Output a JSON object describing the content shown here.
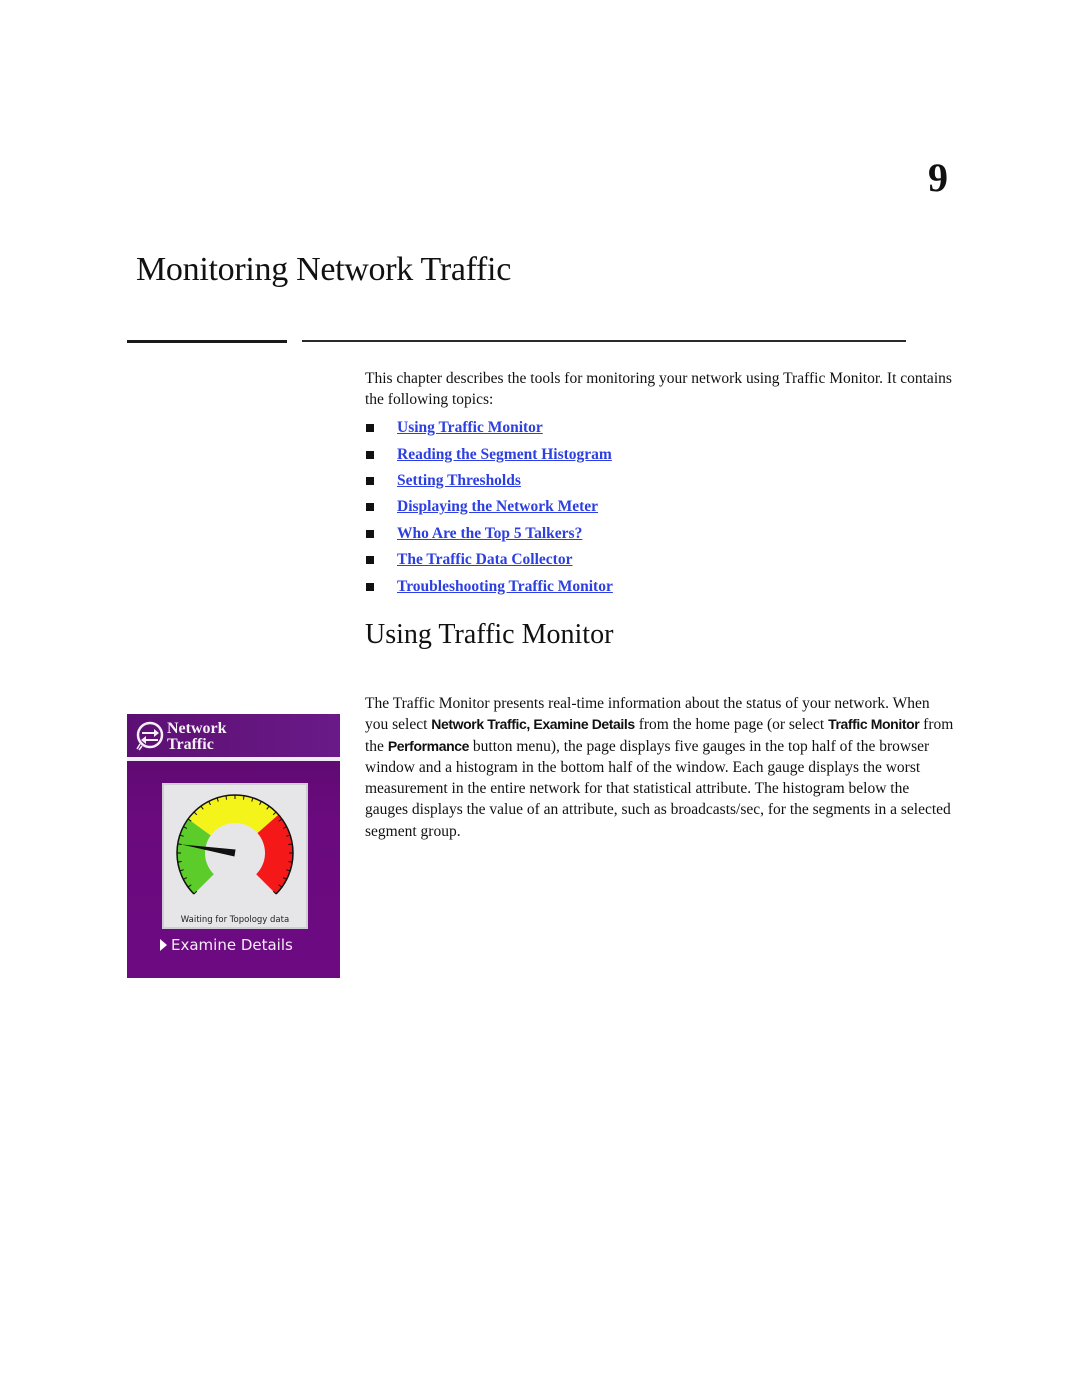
{
  "chapter": {
    "number": "9",
    "title": "Monitoring Network Traffic"
  },
  "intro": {
    "text": "This chapter describes the tools for monitoring your network using Traffic Monitor. It contains the following topics:",
    "topics": [
      "Using Traffic Monitor",
      "Reading the Segment Histogram",
      "Setting Thresholds",
      "Displaying the Network Meter",
      "Who Are the Top 5 Talkers?",
      "The Traffic Data Collector",
      "Troubleshooting Traffic Monitor"
    ]
  },
  "section": {
    "title": "Using Traffic Monitor",
    "body": {
      "p1": "The Traffic Monitor presents real-time information about the status of your network. When you select ",
      "b1": "Network Traffic, Examine Details",
      "p2": " from the home page (or select ",
      "b2": "Traffic Monitor",
      "p3": " from the ",
      "b3": "Performance",
      "p4": " button menu), the page displays five gauges in the top half of the browser window and a histogram in the bottom half of the window. Each gauge displays the worst measurement in the entire network for that statistical attribute. The histogram below the gauges displays the value of an attribute, such as broadcasts/sec, for the segments in a selected segment group."
    }
  },
  "widget": {
    "title_line1": "Network",
    "title_line2": "Traffic",
    "icon": "network-traffic-arrows-icon",
    "gauge_caption": "Waiting for Topology data",
    "gauge_value_fraction": 0.2,
    "gauge_zones": [
      "green",
      "yellow",
      "red"
    ],
    "link_label": "Examine Details",
    "colors": {
      "background": "#6a0a7e",
      "green": "#5ccc2a",
      "yellow": "#f4f41a",
      "red": "#f41818",
      "link": "#2d3fe0"
    }
  }
}
